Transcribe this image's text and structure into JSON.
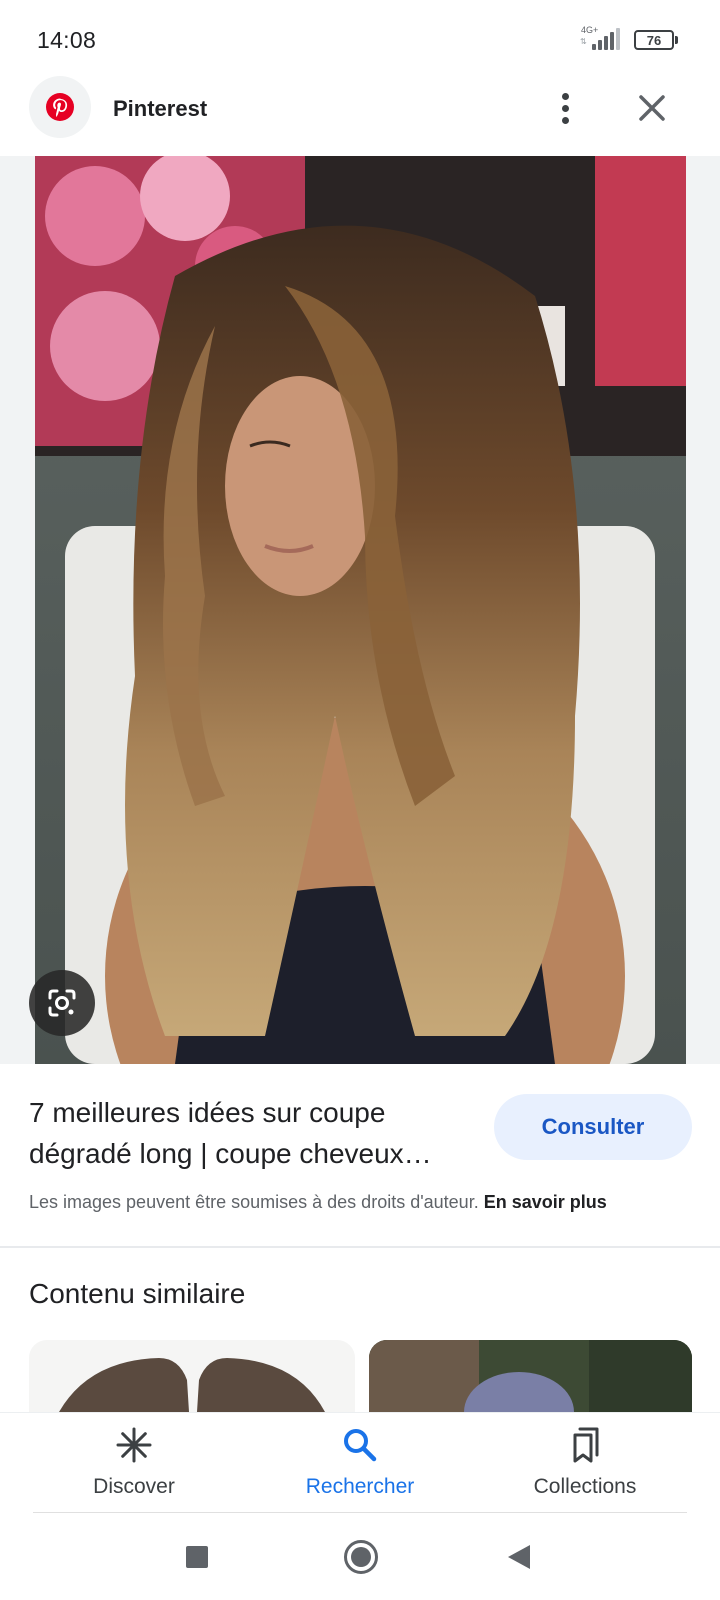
{
  "status_bar": {
    "time": "14:08",
    "network_label": "4G+",
    "signal_level": 0.75,
    "battery_level": "76"
  },
  "header": {
    "site_name": "Pinterest",
    "logo_icon": "pinterest-logo-icon",
    "menu_icon": "more-vert-icon",
    "close_icon": "close-icon",
    "brand_color": "#e60023"
  },
  "result": {
    "title_line1": "7 meilleures idées sur coupe",
    "title_line2": "dégradé long | coupe cheveux…",
    "visit_label": "Consulter",
    "copyright_text": "Les images peuvent être soumises à des droits d'auteur.",
    "learn_more_label": "En savoir plus",
    "lens_icon": "google-lens-icon"
  },
  "similar": {
    "heading": "Contenu similaire"
  },
  "bottom_nav": {
    "items": [
      {
        "label": "Discover",
        "icon": "asterisk-icon",
        "active": false
      },
      {
        "label": "Rechercher",
        "icon": "search-icon",
        "active": true
      },
      {
        "label": "Collections",
        "icon": "bookmarks-icon",
        "active": false
      }
    ],
    "active_color": "#1a73e8"
  },
  "system_nav": {
    "recent_icon": "square-icon",
    "home_icon": "circle-icon",
    "back_icon": "triangle-back-icon"
  }
}
